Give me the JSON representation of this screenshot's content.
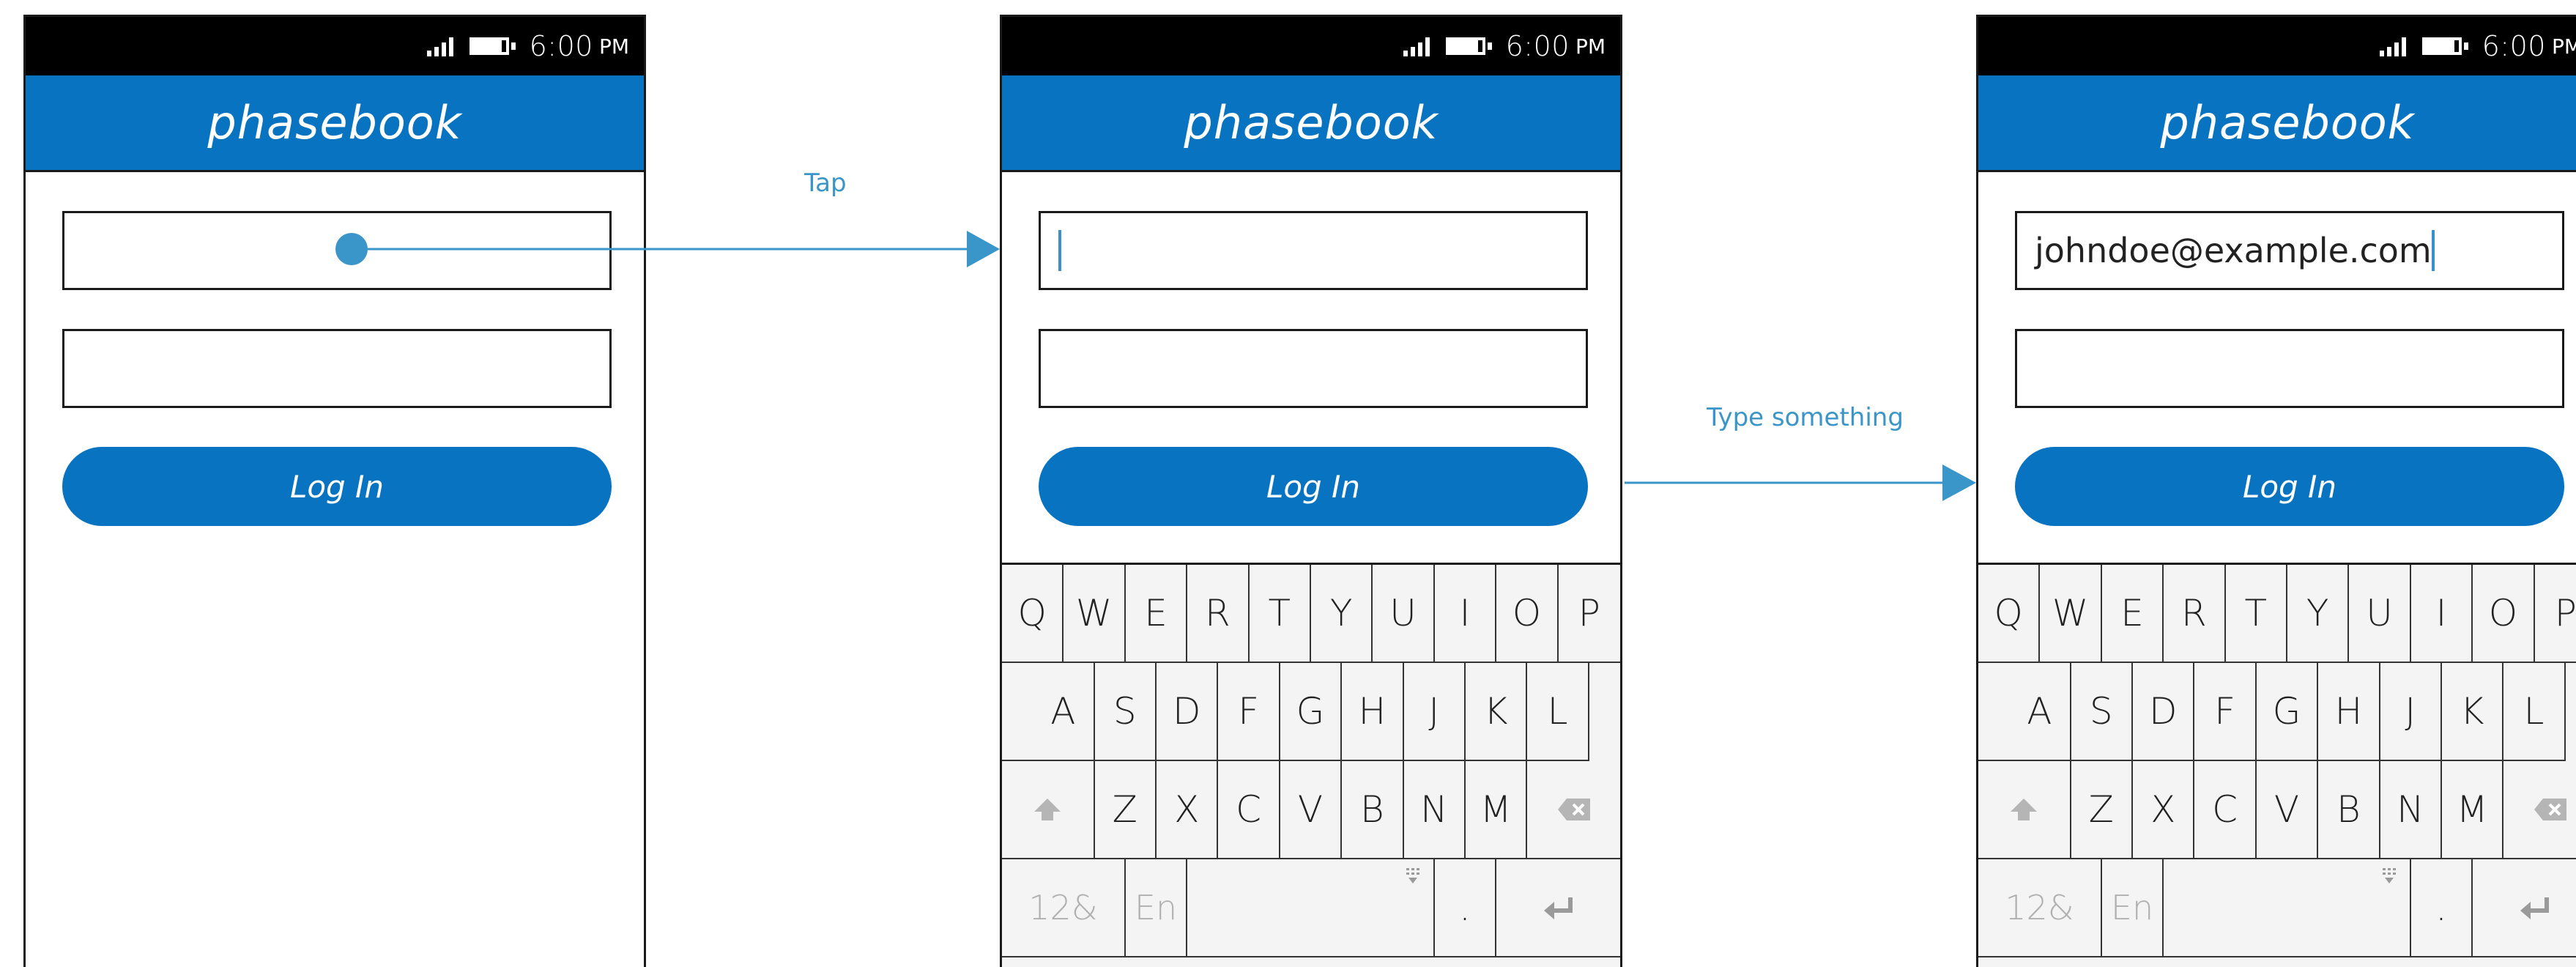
{
  "colors": {
    "brand": "#0873c0",
    "status_bar": "#000000",
    "flow": "#3a96c8",
    "caret": "#3a8fd0",
    "keyboard_bg": "#f4f4f4"
  },
  "status_bar": {
    "time": "6:00",
    "ampm": "PM",
    "icons": [
      "signal-icon",
      "battery-icon"
    ]
  },
  "app": {
    "title": "phasebook",
    "login_label": "Log In"
  },
  "screens": [
    {
      "email_value": "",
      "has_keyboard": false,
      "tap_marker": true
    },
    {
      "email_value": "",
      "has_keyboard": true,
      "caret": true
    },
    {
      "email_value": "johndoe@example.com",
      "has_keyboard": true,
      "caret": true
    }
  ],
  "flow_labels": {
    "tap": "Tap",
    "type": "Type something"
  },
  "keyboard": {
    "row1": [
      "Q",
      "W",
      "E",
      "R",
      "T",
      "Y",
      "U",
      "I",
      "O",
      "P"
    ],
    "row2": [
      "A",
      "S",
      "D",
      "F",
      "G",
      "H",
      "J",
      "K",
      "L"
    ],
    "row3": [
      "Z",
      "X",
      "C",
      "V",
      "B",
      "N",
      "M"
    ],
    "row4": [
      "12&",
      "En",
      ".",
      ""
    ]
  }
}
